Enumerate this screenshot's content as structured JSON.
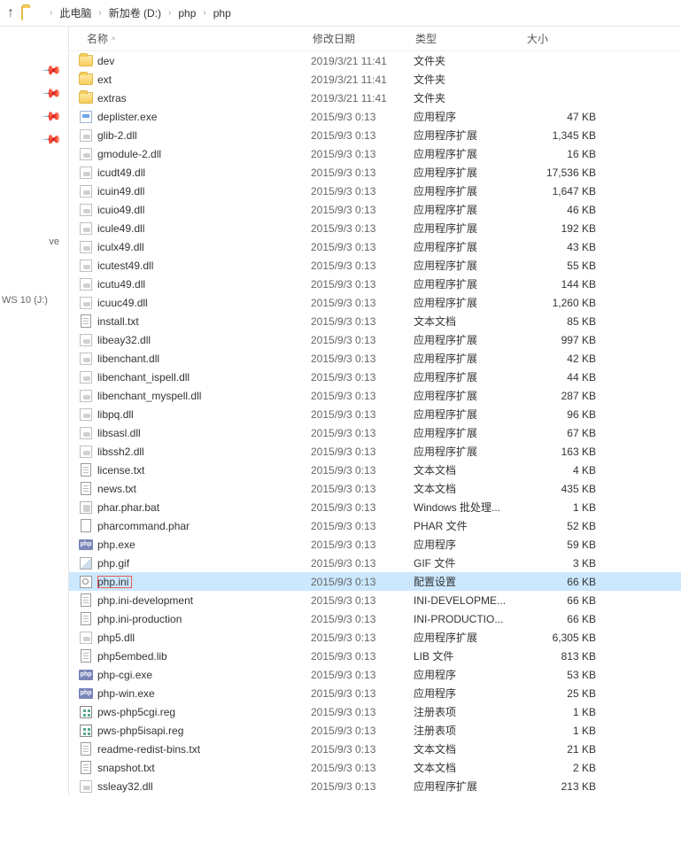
{
  "breadcrumb": {
    "items": [
      "此电脑",
      "新加卷 (D:)",
      "php",
      "php"
    ]
  },
  "left_panel": {
    "items": [
      "",
      "",
      "",
      "",
      "ve",
      "WS 10 (J:)"
    ]
  },
  "headers": {
    "name": "名称",
    "date": "修改日期",
    "type": "类型",
    "size": "大小"
  },
  "files": [
    {
      "icon": "folder",
      "name": "dev",
      "date": "2019/3/21 11:41",
      "type": "文件夹",
      "size": ""
    },
    {
      "icon": "folder",
      "name": "ext",
      "date": "2019/3/21 11:41",
      "type": "文件夹",
      "size": ""
    },
    {
      "icon": "folder",
      "name": "extras",
      "date": "2019/3/21 11:41",
      "type": "文件夹",
      "size": ""
    },
    {
      "icon": "exe",
      "name": "deplister.exe",
      "date": "2015/9/3 0:13",
      "type": "应用程序",
      "size": "47 KB"
    },
    {
      "icon": "dll",
      "name": "glib-2.dll",
      "date": "2015/9/3 0:13",
      "type": "应用程序扩展",
      "size": "1,345 KB"
    },
    {
      "icon": "dll",
      "name": "gmodule-2.dll",
      "date": "2015/9/3 0:13",
      "type": "应用程序扩展",
      "size": "16 KB"
    },
    {
      "icon": "dll",
      "name": "icudt49.dll",
      "date": "2015/9/3 0:13",
      "type": "应用程序扩展",
      "size": "17,536 KB"
    },
    {
      "icon": "dll",
      "name": "icuin49.dll",
      "date": "2015/9/3 0:13",
      "type": "应用程序扩展",
      "size": "1,647 KB"
    },
    {
      "icon": "dll",
      "name": "icuio49.dll",
      "date": "2015/9/3 0:13",
      "type": "应用程序扩展",
      "size": "46 KB"
    },
    {
      "icon": "dll",
      "name": "icule49.dll",
      "date": "2015/9/3 0:13",
      "type": "应用程序扩展",
      "size": "192 KB"
    },
    {
      "icon": "dll",
      "name": "iculx49.dll",
      "date": "2015/9/3 0:13",
      "type": "应用程序扩展",
      "size": "43 KB"
    },
    {
      "icon": "dll",
      "name": "icutest49.dll",
      "date": "2015/9/3 0:13",
      "type": "应用程序扩展",
      "size": "55 KB"
    },
    {
      "icon": "dll",
      "name": "icutu49.dll",
      "date": "2015/9/3 0:13",
      "type": "应用程序扩展",
      "size": "144 KB"
    },
    {
      "icon": "dll",
      "name": "icuuc49.dll",
      "date": "2015/9/3 0:13",
      "type": "应用程序扩展",
      "size": "1,260 KB"
    },
    {
      "icon": "txt",
      "name": "install.txt",
      "date": "2015/9/3 0:13",
      "type": "文本文档",
      "size": "85 KB"
    },
    {
      "icon": "dll",
      "name": "libeay32.dll",
      "date": "2015/9/3 0:13",
      "type": "应用程序扩展",
      "size": "997 KB"
    },
    {
      "icon": "dll",
      "name": "libenchant.dll",
      "date": "2015/9/3 0:13",
      "type": "应用程序扩展",
      "size": "42 KB"
    },
    {
      "icon": "dll",
      "name": "libenchant_ispell.dll",
      "date": "2015/9/3 0:13",
      "type": "应用程序扩展",
      "size": "44 KB"
    },
    {
      "icon": "dll",
      "name": "libenchant_myspell.dll",
      "date": "2015/9/3 0:13",
      "type": "应用程序扩展",
      "size": "287 KB"
    },
    {
      "icon": "dll",
      "name": "libpq.dll",
      "date": "2015/9/3 0:13",
      "type": "应用程序扩展",
      "size": "96 KB"
    },
    {
      "icon": "dll",
      "name": "libsasl.dll",
      "date": "2015/9/3 0:13",
      "type": "应用程序扩展",
      "size": "67 KB"
    },
    {
      "icon": "dll",
      "name": "libssh2.dll",
      "date": "2015/9/3 0:13",
      "type": "应用程序扩展",
      "size": "163 KB"
    },
    {
      "icon": "txt",
      "name": "license.txt",
      "date": "2015/9/3 0:13",
      "type": "文本文档",
      "size": "4 KB"
    },
    {
      "icon": "txt",
      "name": "news.txt",
      "date": "2015/9/3 0:13",
      "type": "文本文档",
      "size": "435 KB"
    },
    {
      "icon": "bat",
      "name": "phar.phar.bat",
      "date": "2015/9/3 0:13",
      "type": "Windows 批处理...",
      "size": "1 KB"
    },
    {
      "icon": "phar",
      "name": "pharcommand.phar",
      "date": "2015/9/3 0:13",
      "type": "PHAR 文件",
      "size": "52 KB"
    },
    {
      "icon": "php",
      "name": "php.exe",
      "date": "2015/9/3 0:13",
      "type": "应用程序",
      "size": "59 KB"
    },
    {
      "icon": "gif",
      "name": "php.gif",
      "date": "2015/9/3 0:13",
      "type": "GIF 文件",
      "size": "3 KB"
    },
    {
      "icon": "ini",
      "name": "php.ini",
      "date": "2015/9/3 0:13",
      "type": "配置设置",
      "size": "66 KB",
      "selected": true
    },
    {
      "icon": "txt",
      "name": "php.ini-development",
      "date": "2015/9/3 0:13",
      "type": "INI-DEVELOPME...",
      "size": "66 KB"
    },
    {
      "icon": "txt",
      "name": "php.ini-production",
      "date": "2015/9/3 0:13",
      "type": "INI-PRODUCTIO...",
      "size": "66 KB"
    },
    {
      "icon": "dll",
      "name": "php5.dll",
      "date": "2015/9/3 0:13",
      "type": "应用程序扩展",
      "size": "6,305 KB"
    },
    {
      "icon": "txt",
      "name": "php5embed.lib",
      "date": "2015/9/3 0:13",
      "type": "LIB 文件",
      "size": "813 KB"
    },
    {
      "icon": "php",
      "name": "php-cgi.exe",
      "date": "2015/9/3 0:13",
      "type": "应用程序",
      "size": "53 KB"
    },
    {
      "icon": "php",
      "name": "php-win.exe",
      "date": "2015/9/3 0:13",
      "type": "应用程序",
      "size": "25 KB"
    },
    {
      "icon": "reg",
      "name": "pws-php5cgi.reg",
      "date": "2015/9/3 0:13",
      "type": "注册表项",
      "size": "1 KB"
    },
    {
      "icon": "reg",
      "name": "pws-php5isapi.reg",
      "date": "2015/9/3 0:13",
      "type": "注册表项",
      "size": "1 KB"
    },
    {
      "icon": "txt",
      "name": "readme-redist-bins.txt",
      "date": "2015/9/3 0:13",
      "type": "文本文档",
      "size": "21 KB"
    },
    {
      "icon": "txt",
      "name": "snapshot.txt",
      "date": "2015/9/3 0:13",
      "type": "文本文档",
      "size": "2 KB"
    },
    {
      "icon": "dll",
      "name": "ssleay32.dll",
      "date": "2015/9/3 0:13",
      "type": "应用程序扩展",
      "size": "213 KB"
    }
  ],
  "icon_labels": {
    "php": "php"
  }
}
